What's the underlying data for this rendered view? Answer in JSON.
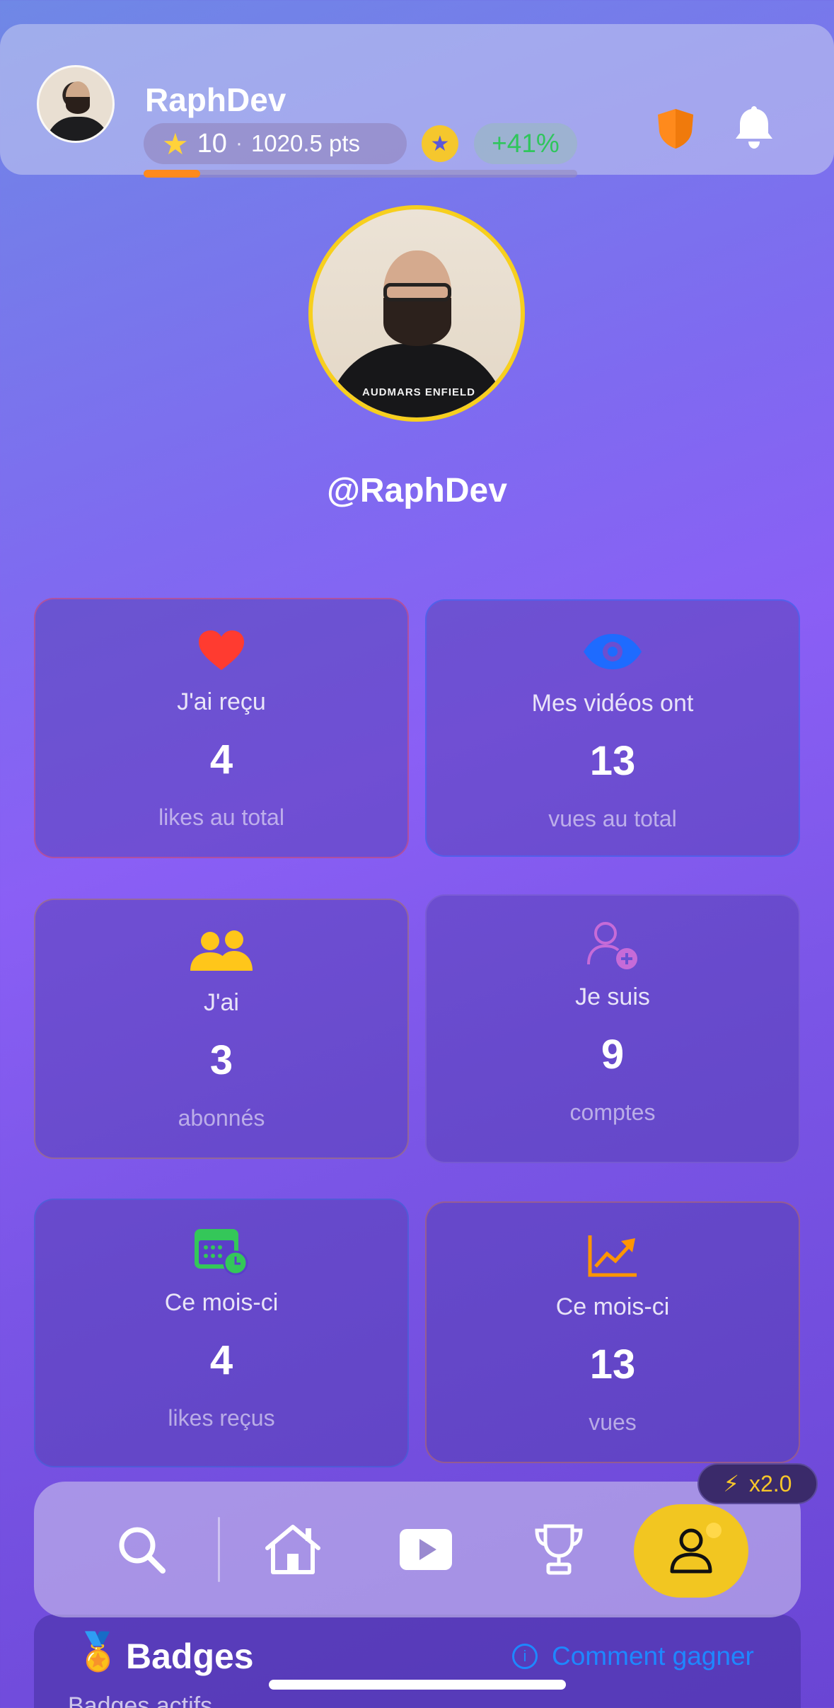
{
  "header": {
    "name": "RaphDev",
    "level": "10",
    "separator": "·",
    "points": "1020.5 pts",
    "growth": "+41%",
    "progress": 0.13,
    "accent": "#ff8a1c"
  },
  "profile": {
    "username": "@RaphDev",
    "shirt_text": "AUDMARS ENFIELD"
  },
  "cards": [
    {
      "icon": "heart-icon",
      "label": "J'ai reçu",
      "value": "4",
      "sub": "likes au total",
      "color": "#ff3b30"
    },
    {
      "icon": "eye-icon",
      "label": "Mes vidéos ont",
      "value": "13",
      "sub": "vues au total",
      "color": "#1e6bff"
    },
    {
      "icon": "users-icon",
      "label": "J'ai",
      "value": "3",
      "sub": "abonnés",
      "color": "#ffc61a"
    },
    {
      "icon": "add-user-icon",
      "label": "Je suis",
      "value": "9",
      "sub": "comptes",
      "color": "#c66bd8"
    },
    {
      "icon": "calendar-clock-icon",
      "label": "Ce mois-ci",
      "value": "4",
      "sub": "likes reçus",
      "color": "#34c759"
    },
    {
      "icon": "trend-up-icon",
      "label": "Ce mois-ci",
      "value": "13",
      "sub": "vues",
      "color": "#ff9500"
    }
  ],
  "badges": {
    "title": "Badges",
    "help_link": "Comment gagner",
    "partial_text": "Badges actifs"
  },
  "nav": {
    "items": [
      "search-icon",
      "home-icon",
      "video-icon",
      "trophy-icon",
      "profile-icon"
    ],
    "active": "profile-icon",
    "boost": "x2.0"
  }
}
